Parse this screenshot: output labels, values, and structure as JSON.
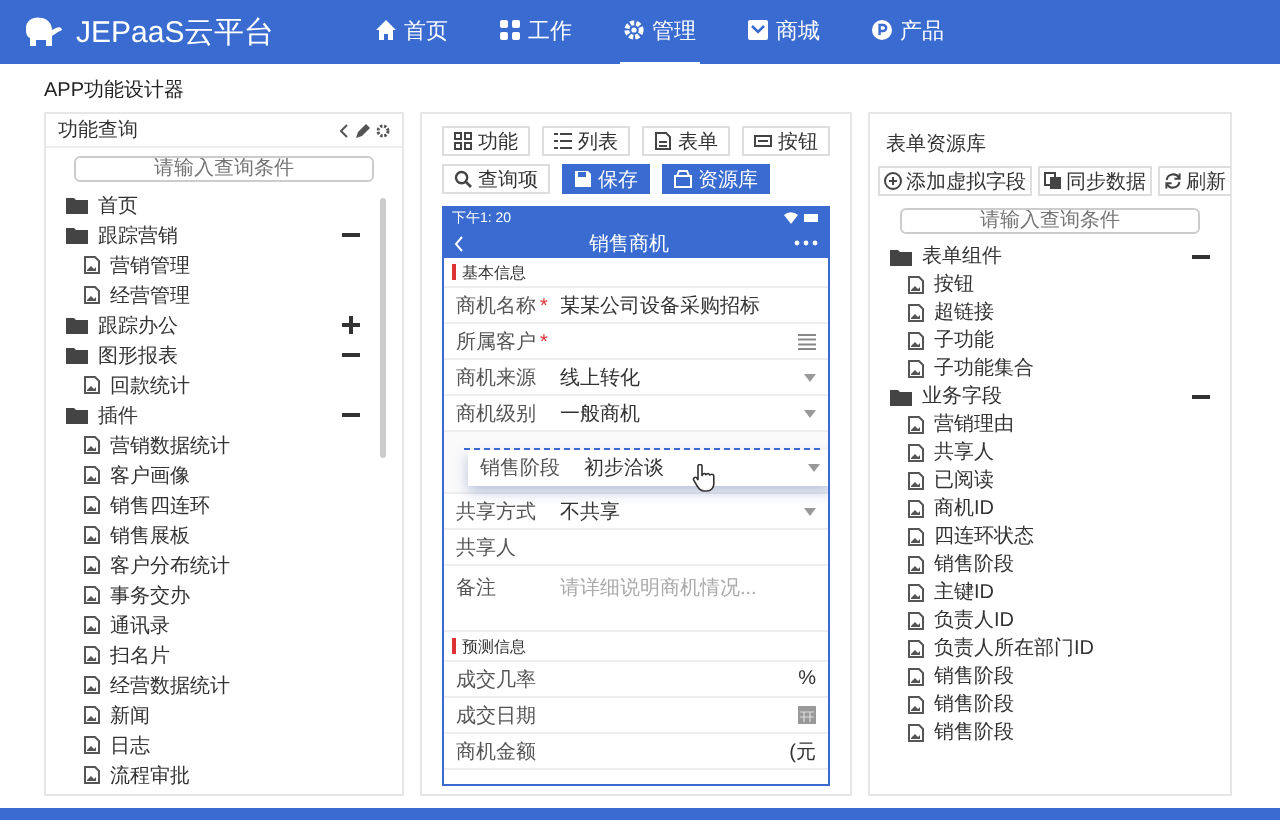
{
  "app_bar": {
    "brand": "JEPaaS云平台",
    "nav": [
      {
        "label": "首页",
        "selected": false
      },
      {
        "label": "工作",
        "selected": false
      },
      {
        "label": "管理",
        "selected": true
      },
      {
        "label": "商城",
        "selected": false
      },
      {
        "label": "产品",
        "selected": false
      }
    ]
  },
  "page_title": "APP功能设计器",
  "function_panel": {
    "title": "功能查询",
    "search": {
      "placeholder": "请输入查询条件"
    },
    "tree": [
      {
        "label": "首页",
        "kind": "folder"
      },
      {
        "label": "跟踪营销",
        "kind": "folder",
        "expanded": true,
        "children": [
          {
            "label": "营销管理",
            "kind": "page"
          },
          {
            "label": "经营管理",
            "kind": "page"
          }
        ]
      },
      {
        "label": "跟踪办公",
        "kind": "folder",
        "expanded": false
      },
      {
        "label": "图形报表",
        "kind": "folder",
        "expanded": true,
        "children": [
          {
            "label": "回款统计",
            "kind": "page"
          }
        ]
      },
      {
        "label": "插件",
        "kind": "folder",
        "expanded": true,
        "children": [
          {
            "label": "营销数据统计",
            "kind": "page"
          },
          {
            "label": "客户画像",
            "kind": "page"
          },
          {
            "label": "销售四连环",
            "kind": "page"
          },
          {
            "label": "销售展板",
            "kind": "page"
          },
          {
            "label": "客户分布统计",
            "kind": "page"
          },
          {
            "label": "事务交办",
            "kind": "page"
          },
          {
            "label": "通讯录",
            "kind": "page"
          },
          {
            "label": "扫名片",
            "kind": "page"
          },
          {
            "label": "经营数据统计",
            "kind": "page"
          },
          {
            "label": "新闻",
            "kind": "page"
          },
          {
            "label": "日志",
            "kind": "page"
          },
          {
            "label": "流程审批",
            "kind": "page"
          }
        ]
      }
    ]
  },
  "designer": {
    "toolbar": [
      {
        "label": "功能",
        "kind": "plain"
      },
      {
        "label": "列表",
        "kind": "plain"
      },
      {
        "label": "表单",
        "kind": "plain"
      },
      {
        "label": "按钮",
        "kind": "plain"
      },
      {
        "label": "查询项",
        "kind": "plain"
      },
      {
        "label": "保存",
        "kind": "primary"
      },
      {
        "label": "资源库",
        "kind": "primary"
      }
    ],
    "phone": {
      "time": "下午1: 20",
      "title": "销售商机",
      "sections": [
        {
          "title": "基本信息",
          "fields": [
            {
              "label": "商机名称",
              "mark": "*",
              "value": "某某公司设备采购招标",
              "kind": "text"
            },
            {
              "label": "所属客户",
              "mark": "*",
              "kind": "picker"
            },
            {
              "label": "商机来源",
              "value": "线上转化",
              "kind": "select"
            },
            {
              "label": "商机级别",
              "value": "一般商机",
              "kind": "select"
            },
            {
              "label": "销售阶段",
              "value": "初步洽谈",
              "kind": "dragging"
            },
            {
              "label": "共享方式",
              "value": "不共享",
              "kind": "select"
            },
            {
              "label": "共享人",
              "kind": "text"
            },
            {
              "label": "备注",
              "placeholder": "请详细说明商机情况...",
              "kind": "textarea"
            }
          ]
        },
        {
          "title": "预测信息",
          "fields": [
            {
              "label": "成交几率",
              "suffix": "%",
              "kind": "text"
            },
            {
              "label": "成交日期",
              "kind": "date"
            },
            {
              "label": "商机金额",
              "suffix": "(元",
              "kind": "text"
            }
          ]
        }
      ]
    }
  },
  "resources": {
    "title": "表单资源库",
    "buttons": [
      "添加虚拟字段",
      "同步数据",
      "刷新"
    ],
    "search": {
      "placeholder": "请输入查询条件"
    },
    "tree": [
      {
        "label": "表单组件",
        "kind": "folder",
        "expanded": true,
        "children": [
          {
            "label": "按钮",
            "kind": "page"
          },
          {
            "label": "超链接",
            "kind": "page"
          },
          {
            "label": "子功能",
            "kind": "page"
          },
          {
            "label": "子功能集合",
            "kind": "page"
          }
        ]
      },
      {
        "label": "业务字段",
        "kind": "folder",
        "expanded": true,
        "children": [
          {
            "label": "营销理由",
            "kind": "page"
          },
          {
            "label": "共享人",
            "kind": "page"
          },
          {
            "label": "已阅读",
            "kind": "page"
          },
          {
            "label": "商机ID",
            "kind": "page"
          },
          {
            "label": "四连环状态",
            "kind": "page"
          },
          {
            "label": "销售阶段",
            "kind": "page"
          },
          {
            "label": "主键ID",
            "kind": "page"
          },
          {
            "label": "负责人ID",
            "kind": "page"
          },
          {
            "label": "负责人所在部门ID",
            "kind": "page"
          },
          {
            "label": "销售阶段",
            "kind": "page"
          },
          {
            "label": "销售阶段",
            "kind": "page"
          },
          {
            "label": "销售阶段",
            "kind": "page"
          }
        ]
      }
    ]
  }
}
